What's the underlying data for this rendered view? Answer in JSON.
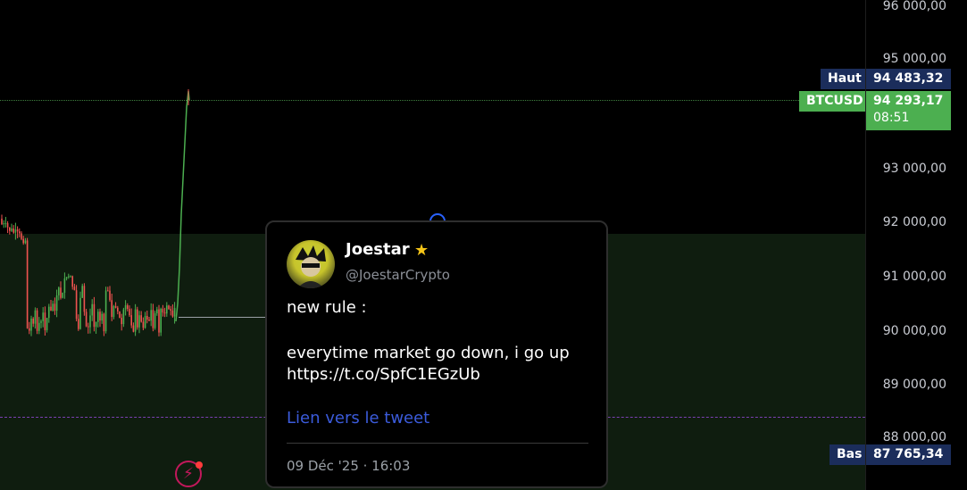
{
  "price_scale": {
    "ticks": [
      "96 000,00",
      "95 000,00",
      "93 000,00",
      "92 000,00",
      "91 000,00",
      "90 000,00",
      "89 000,00",
      "88 000,00"
    ]
  },
  "labels": {
    "high_tag": "Haut",
    "high_value": "94 483,32",
    "symbol_tag": "BTCUSD",
    "last_value": "94 293,17",
    "countdown": "08:51",
    "low_tag": "Bas",
    "low_value": "87 765,34"
  },
  "tweet": {
    "author_name": "Joestar",
    "author_handle": "@JoestarCrypto",
    "line1": "new rule :",
    "line2": "everytime market go down, i go up",
    "line3": "https://t.co/SpfC1EGzUb",
    "link_label": "Lien vers le tweet",
    "date": "09 Déc '25 · 16:03",
    "star_icon": "star-icon",
    "verified_color": "#f5c518"
  },
  "colors": {
    "up": "#4caf50",
    "down": "#ef5350",
    "accent": "#2962ff",
    "zone": "#0f1d0f"
  }
}
